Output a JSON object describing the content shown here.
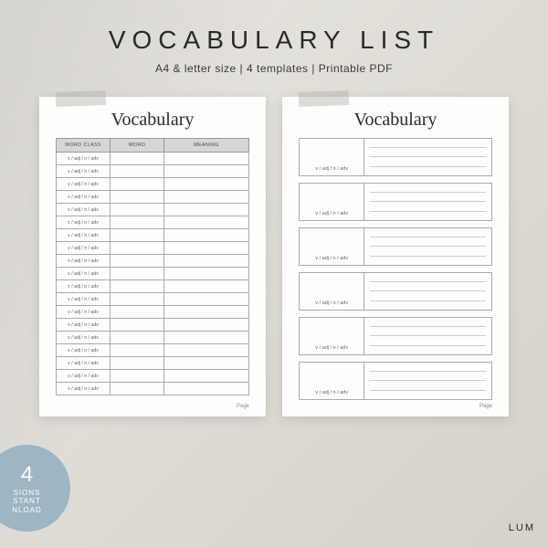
{
  "header": {
    "title": "VOCABULARY LIST",
    "subtitle": "A4 & letter size | 4 templates | Printable PDF"
  },
  "page_heading": "Vocabulary",
  "table": {
    "headers": [
      "WORD CLASS",
      "WORD",
      "MEANING"
    ],
    "row_text": "v / adj / n / adv",
    "row_count": 19
  },
  "cards": {
    "label": "v / adj / n / adv",
    "count": 6
  },
  "page_footer": "Page",
  "badge": {
    "number": "4",
    "line1": "SIONS",
    "line2": "STANT",
    "line3": "NLOAD"
  },
  "brand": "LUM"
}
